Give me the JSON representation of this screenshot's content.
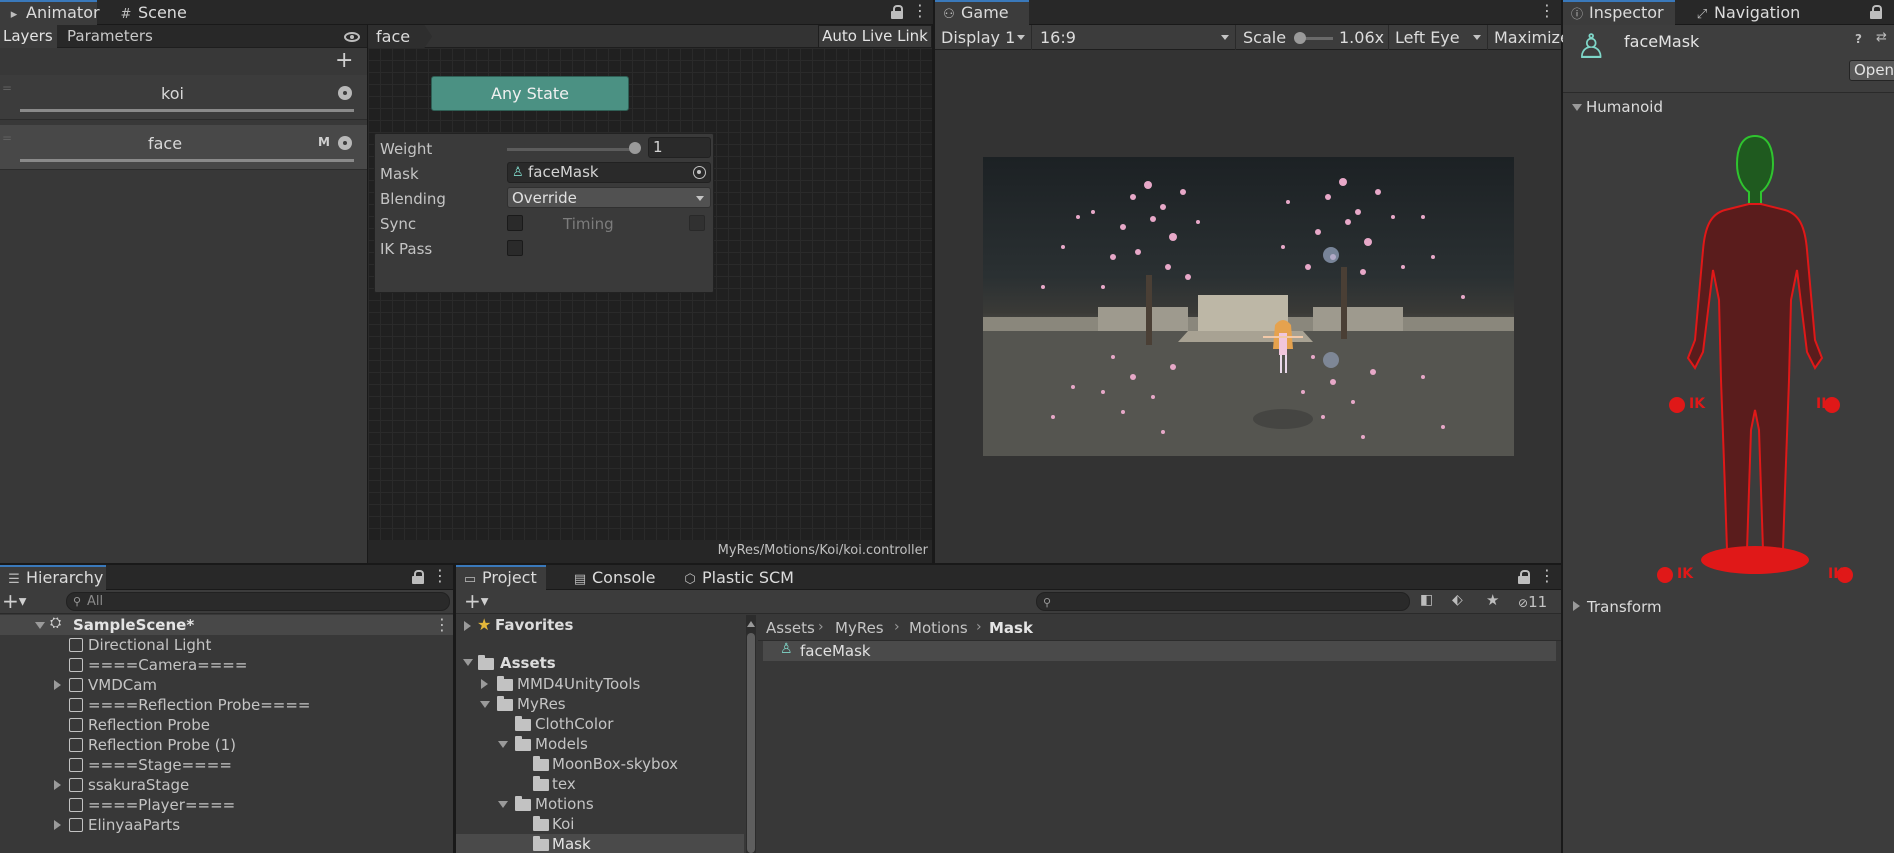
{
  "animator": {
    "tabs": [
      {
        "label": "Animator",
        "icon": "animator-icon"
      },
      {
        "label": "Scene",
        "icon": "scene-grid-icon"
      }
    ],
    "subtabs": [
      "Layers",
      "Parameters"
    ],
    "breadcrumb": "face",
    "auto_live_link": "Auto Live Link",
    "layers": [
      {
        "name": "koi",
        "badge": ""
      },
      {
        "name": "face",
        "badge": "M"
      }
    ],
    "any_state": "Any State",
    "popup": {
      "weight_label": "Weight",
      "weight_value": "1",
      "weight_fraction": 1.0,
      "mask_label": "Mask",
      "mask_value": "faceMask",
      "blending_label": "Blending",
      "blending_value": "Override",
      "sync_label": "Sync",
      "timing_label": "Timing",
      "ik_pass_label": "IK Pass"
    },
    "controller_path": "MyRes/Motions/Koi/koi.controller"
  },
  "game": {
    "tab": "Game",
    "display": "Display 1",
    "aspect": "16:9",
    "scale_label": "Scale",
    "scale_value": "1.06x",
    "eye": "Left Eye",
    "maximize": "Maximize"
  },
  "inspector": {
    "tabs": [
      {
        "label": "Inspector",
        "icon": "info-icon"
      },
      {
        "label": "Navigation",
        "icon": "navigation-icon"
      }
    ],
    "object_name": "faceMask",
    "open_button": "Open",
    "humanoid_label": "Humanoid",
    "ik_labels": [
      "IK",
      "IK",
      "IK",
      "IK"
    ],
    "transform_label": "Transform",
    "colors": {
      "head": "#2fc42f",
      "body": "#e01818"
    }
  },
  "hierarchy": {
    "tab": "Hierarchy",
    "search_placeholder": "All",
    "scene": "SampleScene*",
    "items": [
      {
        "label": "Directional Light",
        "expandable": false
      },
      {
        "label": "====Camera====",
        "expandable": false
      },
      {
        "label": "VMDCam",
        "expandable": true
      },
      {
        "label": "====Reflection Probe====",
        "expandable": false
      },
      {
        "label": "Reflection Probe",
        "expandable": false
      },
      {
        "label": "Reflection Probe (1)",
        "expandable": false
      },
      {
        "label": "====Stage====",
        "expandable": false
      },
      {
        "label": "ssakuraStage",
        "expandable": true
      },
      {
        "label": "====Player====",
        "expandable": false
      },
      {
        "label": "ElinyaaParts",
        "expandable": true
      }
    ]
  },
  "project": {
    "tabs": [
      {
        "label": "Project",
        "icon": "folder-icon"
      },
      {
        "label": "Console",
        "icon": "console-icon"
      },
      {
        "label": "Plastic SCM",
        "icon": "plastic-scm-icon"
      }
    ],
    "hidden_count": "11",
    "favorites": "Favorites",
    "assets": "Assets",
    "tree": [
      {
        "label": "MMD4UnityTools",
        "depth": 1,
        "state": "collapsed"
      },
      {
        "label": "MyRes",
        "depth": 1,
        "state": "expanded"
      },
      {
        "label": "ClothColor",
        "depth": 2,
        "state": "leaf"
      },
      {
        "label": "Models",
        "depth": 2,
        "state": "expanded"
      },
      {
        "label": "MoonBox-skybox",
        "depth": 3,
        "state": "leaf"
      },
      {
        "label": "tex",
        "depth": 3,
        "state": "leaf"
      },
      {
        "label": "Motions",
        "depth": 2,
        "state": "expanded"
      },
      {
        "label": "Koi",
        "depth": 3,
        "state": "leaf"
      },
      {
        "label": "Mask",
        "depth": 3,
        "state": "leaf"
      }
    ],
    "breadcrumb": [
      "Assets",
      "MyRes",
      "Motions",
      "Mask"
    ],
    "files": [
      "faceMask"
    ]
  }
}
